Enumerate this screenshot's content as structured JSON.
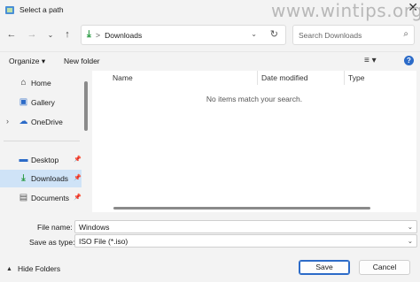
{
  "window": {
    "title": "Select a path",
    "close_glyph": "✕"
  },
  "watermark": "www.wintips.org",
  "nav": {
    "back_icon": "arrow-left",
    "forward_icon": "arrow-right",
    "dropdown_icon": "chevron-down",
    "up_icon": "arrow-up",
    "address": {
      "separator": ">",
      "path": "Downloads"
    },
    "search": {
      "placeholder": "Search Downloads"
    }
  },
  "toolbar": {
    "organize_label": "Organize ▾",
    "new_folder_label": "New folder"
  },
  "sidebar": {
    "items": [
      {
        "label": "Home"
      },
      {
        "label": "Gallery"
      },
      {
        "label": "OneDrive"
      },
      {
        "label": "Desktop"
      },
      {
        "label": "Downloads"
      },
      {
        "label": "Documents"
      }
    ]
  },
  "main": {
    "columns": [
      "Name",
      "Date modified",
      "Type"
    ],
    "empty_message": "No items match your search."
  },
  "form": {
    "file_name_label": "File name:",
    "file_name_value": "Windows",
    "save_as_type_label": "Save as type:",
    "save_as_type_value": "ISO File (*.iso)"
  },
  "footer": {
    "hide_folders_label": "Hide Folders",
    "save_label": "Save",
    "cancel_label": "Cancel"
  },
  "colors": {
    "accent": "#2c6bc8",
    "selection": "#cfe3f7",
    "download_green": "#2b9b44"
  }
}
